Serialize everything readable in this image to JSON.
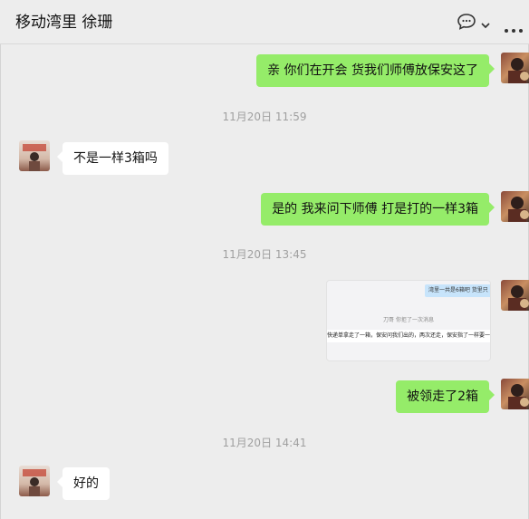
{
  "header": {
    "title": "移动湾里 徐珊",
    "icons": [
      "chat-bubble-icon",
      "chevron-down-icon",
      "more-icon"
    ]
  },
  "messages": [
    {
      "side": "self",
      "text": "亲 你们在开会 货我们师傅放保安这了"
    },
    {
      "type": "time",
      "text": "11月20日 11:59"
    },
    {
      "side": "other",
      "text": "不是一样3箱吗"
    },
    {
      "side": "self",
      "text": "是的 我来问下师傅 打是打的一样3箱"
    },
    {
      "type": "time",
      "text": "11月20日 13:45"
    },
    {
      "side": "self",
      "type": "image",
      "image_text": {
        "top": "湾里一共是6箱吧 货里只",
        "middle": "刀哥 你拒了一次消息",
        "bottom": "快递单拿走了一箱，保安问我们出的，两次还走，保安指了一样要一样拉一箱"
      }
    },
    {
      "side": "self",
      "text": "被领走了2箱"
    },
    {
      "type": "time",
      "text": "11月20日 14:41"
    },
    {
      "side": "other",
      "text": "好的"
    }
  ],
  "colors": {
    "background": "#ededed",
    "self_bubble": "#95ec69",
    "other_bubble": "#ffffff",
    "timestamp": "#a0a0a0"
  }
}
